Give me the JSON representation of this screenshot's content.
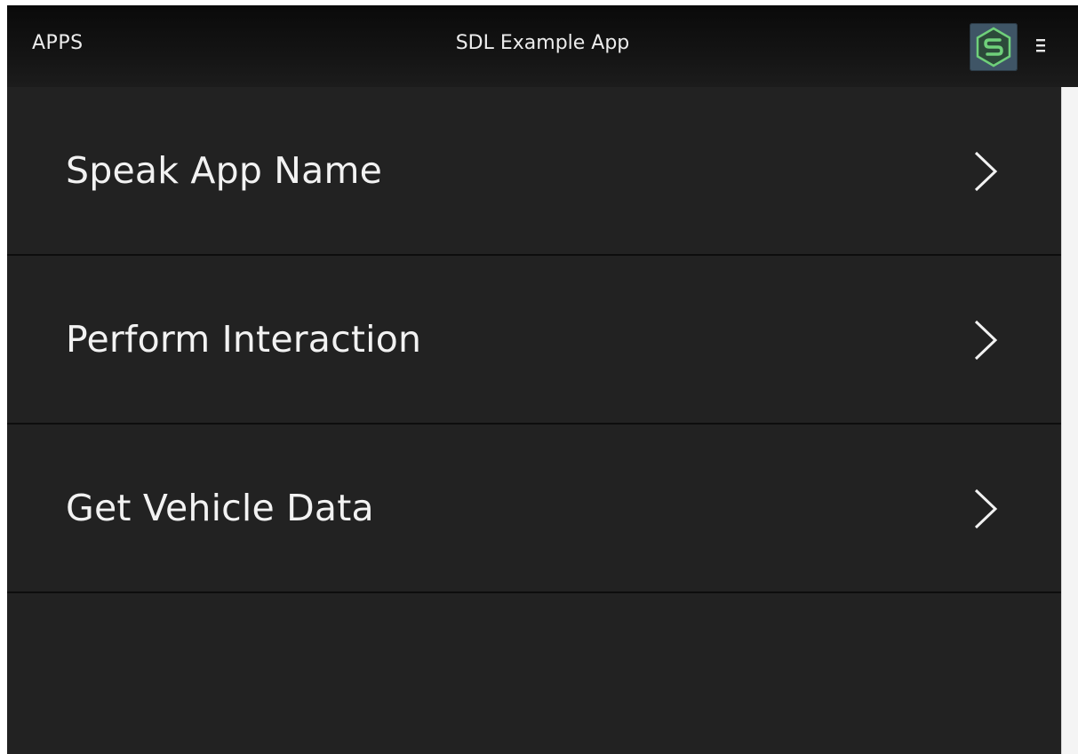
{
  "header": {
    "apps_label": "APPS",
    "title": "SDL Example App",
    "app_icon": "sdl-logo-icon",
    "menu_icon": "hamburger-menu-icon"
  },
  "menu": {
    "items": [
      {
        "label": "Speak App Name",
        "icon": "chevron-right-icon"
      },
      {
        "label": "Perform Interaction",
        "icon": "chevron-right-icon"
      },
      {
        "label": "Get Vehicle Data",
        "icon": "chevron-right-icon"
      }
    ]
  },
  "colors": {
    "background": "#222222",
    "header": "#0a0a0a",
    "text": "#f2f2f2",
    "divider": "#0d0d0d",
    "logo_accent": "#6fd07a"
  }
}
